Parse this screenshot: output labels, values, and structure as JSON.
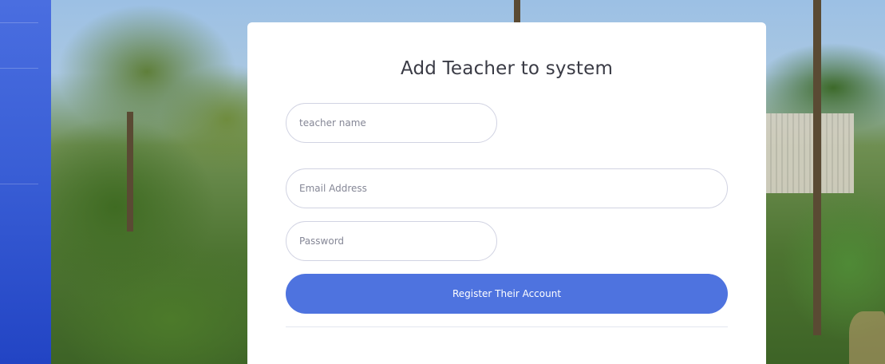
{
  "form": {
    "title": "Add Teacher to system",
    "teacher_name_placeholder": "teacher name",
    "email_placeholder": "Email Address",
    "password_placeholder": "Password",
    "submit_label": "Register Their Account"
  },
  "colors": {
    "sidebar_top": "#4a6ee0",
    "sidebar_bottom": "#2244c4",
    "primary_button": "#4e73df",
    "card_background": "#ffffff",
    "title_text": "#3a3b45"
  }
}
